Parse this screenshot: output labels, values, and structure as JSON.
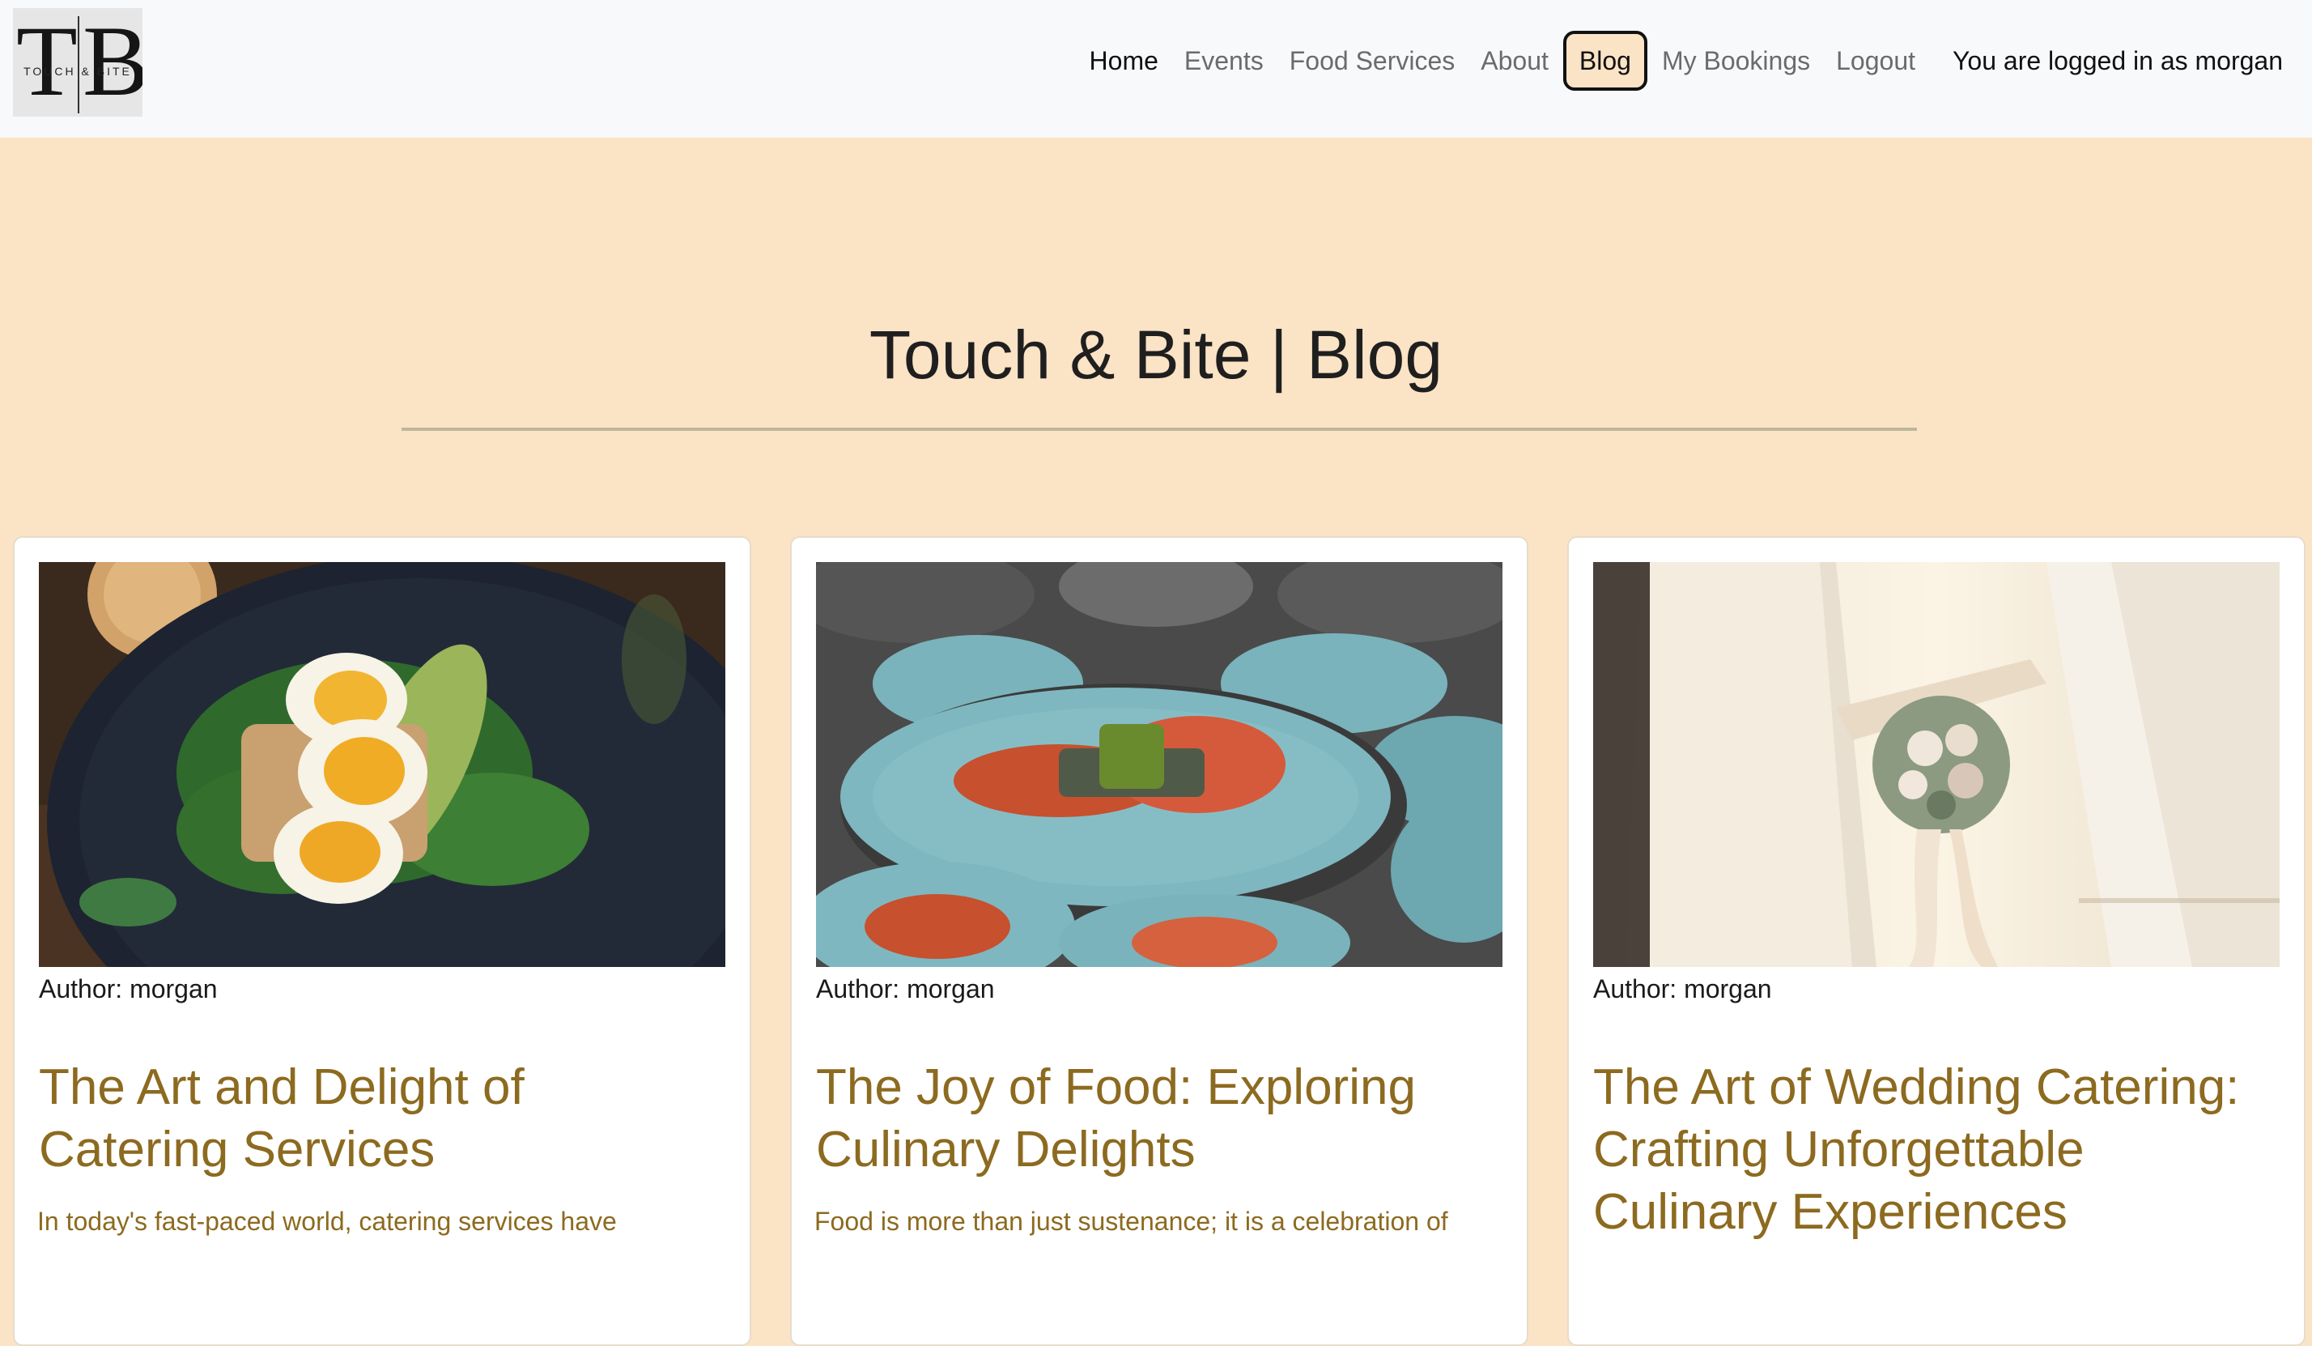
{
  "brand": {
    "logo_letter_left": "T",
    "logo_letter_right": "B",
    "logo_small_text": "TOUCH & BITE"
  },
  "nav": {
    "home": "Home",
    "events": "Events",
    "food_services": "Food Services",
    "about": "About",
    "blog": "Blog",
    "my_bookings": "My Bookings",
    "logout": "Logout",
    "logged_in_text": "You are logged in as morgan"
  },
  "header": {
    "title": "Touch & Bite | Blog"
  },
  "posts": [
    {
      "author": "Author: morgan",
      "title": "The Art and Delight of Catering Services",
      "excerpt": "In today's fast-paced world, catering services have"
    },
    {
      "author": "Author: morgan",
      "title": "The Joy of Food: Exploring Culinary Delights",
      "excerpt": "Food is more than just sustenance; it is a celebration of"
    },
    {
      "author": "Author: morgan",
      "title": "The Art of Wedding Catering: Crafting Unforgettable Culinary Experiences",
      "excerpt": ""
    }
  ],
  "colors": {
    "page_background": "#fbe3c6",
    "navbar_background": "#f8f9fb",
    "post_title": "#8c6a1f",
    "rule": "#bdb89a"
  }
}
